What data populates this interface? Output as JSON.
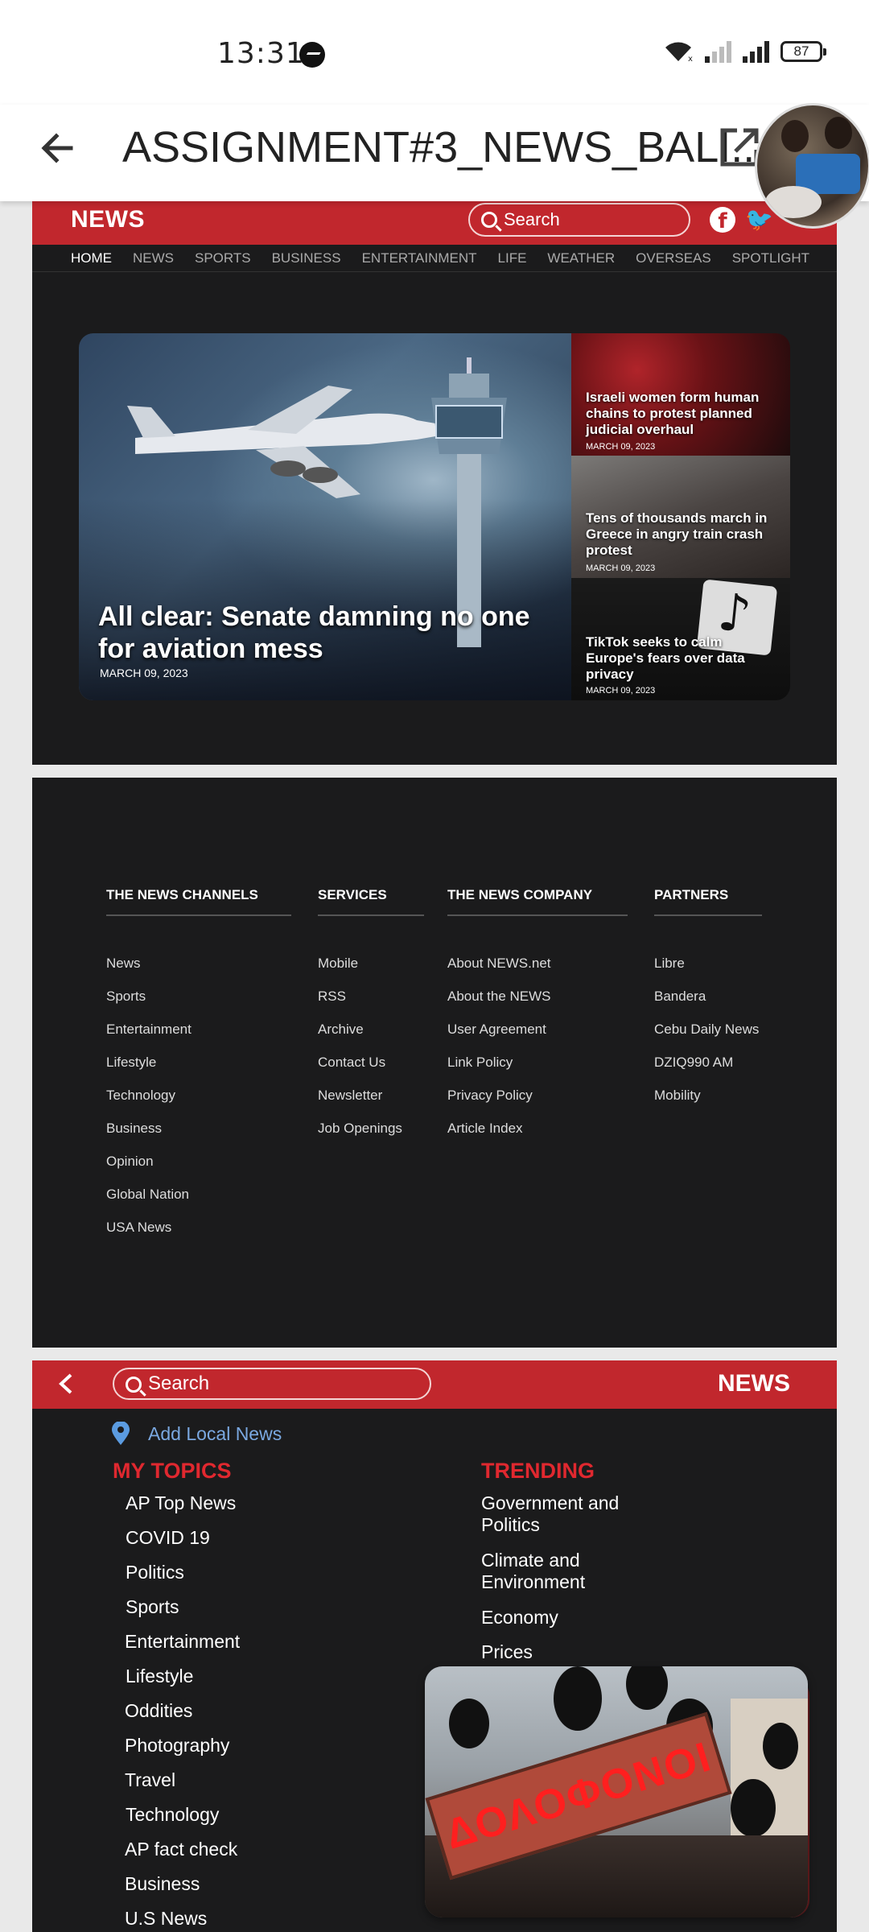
{
  "status_bar": {
    "time": "13:31",
    "battery": "87"
  },
  "app_bar": {
    "title": "ASSIGNMENT#3_NEWS_BALI..."
  },
  "site": {
    "logo": "NEWS",
    "search_placeholder": "Search",
    "nav": [
      "HOME",
      "NEWS",
      "SPORTS",
      "BUSINESS",
      "ENTERTAINMENT",
      "LIFE",
      "WEATHER",
      "OVERSEAS",
      "SPOTLIGHT"
    ],
    "nav_active": "HOME",
    "hero": {
      "title": "All clear: Senate damning no one for aviation mess",
      "date": "MARCH 09, 2023"
    },
    "side_stories": [
      {
        "title": "Israeli women form human chains to protest planned judicial overhaul",
        "date": "MARCH 09, 2023"
      },
      {
        "title": "Tens of thousands march in Greece in angry train crash protest",
        "date": "MARCH 09, 2023"
      },
      {
        "title": "TikTok seeks to calm Europe's fears over data privacy",
        "date": "MARCH 09, 2023"
      }
    ]
  },
  "footer": {
    "columns": [
      {
        "heading": "THE NEWS CHANNELS",
        "items": [
          "News",
          "Sports",
          "Entertainment",
          "Lifestyle",
          "Technology",
          "Business",
          "Opinion",
          "Global Nation",
          "USA News"
        ]
      },
      {
        "heading": "SERVICES",
        "items": [
          "Mobile",
          "RSS",
          "Archive",
          "Contact Us",
          "Newsletter",
          "Job Openings"
        ]
      },
      {
        "heading": "THE NEWS COMPANY",
        "items": [
          "About NEWS.net",
          "About the NEWS",
          "User Agreement",
          "Link Policy",
          "Privacy Policy",
          "Article Index"
        ]
      },
      {
        "heading": "PARTNERS",
        "items": [
          "Libre",
          "Bandera",
          "Cebu Daily News",
          "DZIQ990 AM",
          "Mobility"
        ]
      }
    ]
  },
  "menu": {
    "search_placeholder": "Search",
    "logo": "NEWS",
    "add_local": "Add Local News",
    "my_topics_heading": "MY TOPICS",
    "my_topics": [
      "AP Top News",
      "COVID 19",
      "Politics",
      "Sports",
      "Entertainment",
      "Lifestyle",
      "Oddities",
      "Photography",
      "Travel",
      "Technology",
      "AP fact check",
      "Business",
      "U.S News"
    ],
    "trending_heading": "TRENDING",
    "trending": [
      "Government and Politics",
      "Climate and Environment",
      "Economy",
      "Prices"
    ]
  },
  "pip": {
    "sign_text": "ΔΟΛΟΦΟΝΟΙ"
  },
  "colors": {
    "brand_red": "#c1272d",
    "panel_bg": "#1b1b1c",
    "accent_blue": "#7aa8e0",
    "heading_red": "#e0282f"
  }
}
